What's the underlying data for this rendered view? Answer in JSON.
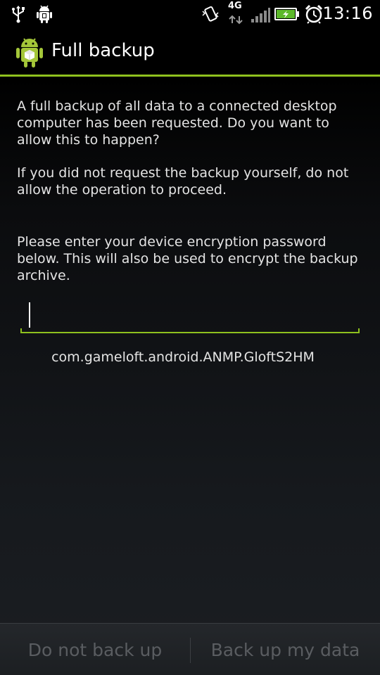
{
  "status_bar": {
    "time": "13:16",
    "network": "4G",
    "icons": [
      "usb-icon",
      "android-debug-icon",
      "vibrate-icon",
      "network-4g-icon",
      "signal-icon",
      "battery-charging-icon",
      "alarm-icon"
    ]
  },
  "title_bar": {
    "title": "Full backup",
    "icon": "android-backup-icon"
  },
  "dialog": {
    "message_1": "A full backup of all data to a connected desktop computer has been requested. Do you want to allow this to happen?",
    "message_2": "If you did not request the backup yourself, do not allow the operation to proceed.",
    "message_3": "Please enter your device encryption password below. This will also be used to encrypt the backup archive.",
    "password_value": "",
    "package_name": "com.gameloft.android.ANMP.GloftS2HM"
  },
  "buttons": {
    "deny_label": "Do not back up",
    "allow_label": "Back up my data"
  },
  "colors": {
    "accent": "#8fc11e",
    "text": "#e4e4e4",
    "button_disabled_text": "#5a5d61"
  }
}
